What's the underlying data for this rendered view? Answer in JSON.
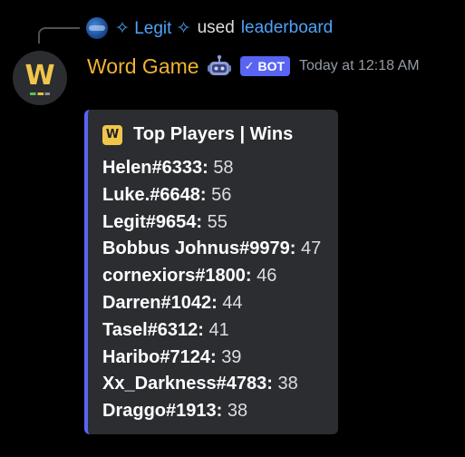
{
  "reply": {
    "user": "✧ Legit ✧",
    "verb": "used",
    "command": "leaderboard"
  },
  "message": {
    "username": "Word Game",
    "avatar_letter": "W",
    "bot_badge": "BOT",
    "bot_check": "✓",
    "timestamp": "Today at 12:18 AM"
  },
  "embed": {
    "icon_letter": "W",
    "title": "Top Players | Wins",
    "accent_color": "#5865f2",
    "players": [
      {
        "name": "Helen#6333:",
        "wins": "58"
      },
      {
        "name": "Luke.#6648:",
        "wins": "56"
      },
      {
        "name": "Legit#9654:",
        "wins": "55"
      },
      {
        "name": "Bobbus Johnus#9979:",
        "wins": "47"
      },
      {
        "name": "cornexiors#1800:",
        "wins": "46"
      },
      {
        "name": "Darren#1042:",
        "wins": "44"
      },
      {
        "name": "Tasel#6312:",
        "wins": "41"
      },
      {
        "name": "Haribo#7124:",
        "wins": "39"
      },
      {
        "name": "Xx_Darkness#4783:",
        "wins": "38"
      },
      {
        "name": "Draggo#1913:",
        "wins": "38"
      }
    ]
  },
  "icons": {
    "reply_avatar": "user-avatar-icon",
    "bot_emoji": "robot-icon",
    "embed_icon": "word-game-logo-icon"
  },
  "colors": {
    "username": "#f0b232",
    "link": "#4fa3f7",
    "bot_badge": "#5865f2",
    "timestamp": "#949ba4",
    "embed_bg": "#2b2d31"
  }
}
